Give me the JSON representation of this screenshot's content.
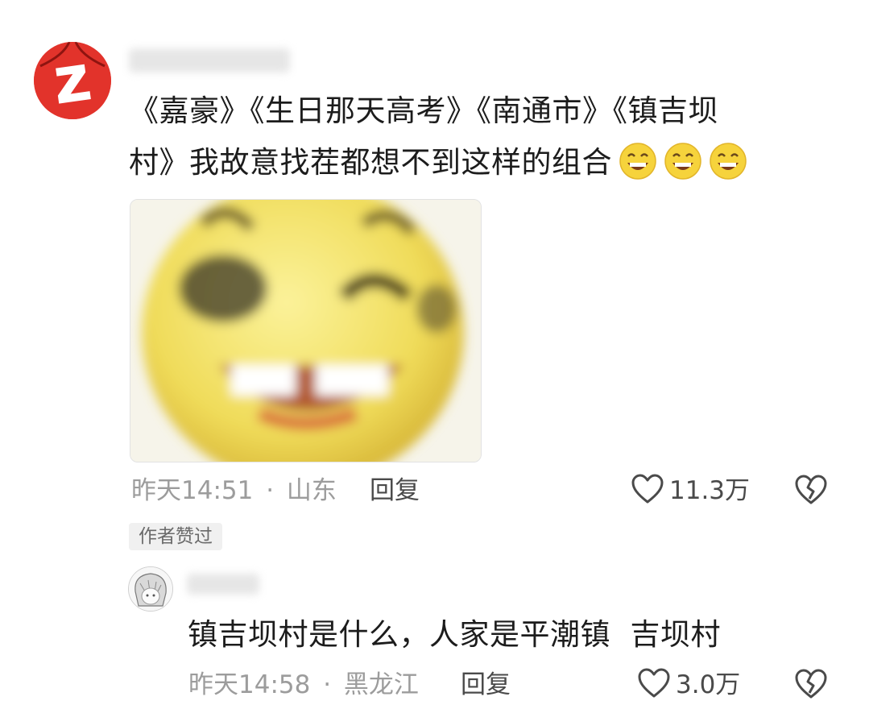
{
  "comment": {
    "username": "",
    "text_line1": "《嘉豪》《生日那天高考》《南通市》《镇吉坝",
    "text_line2": "村》我故意找茬都想不到这样的组合",
    "emojis": [
      "grinning-face",
      "grinning-face",
      "grinning-face"
    ],
    "time": "昨天14:51",
    "dot": "·",
    "location": "山东",
    "reply_label": "回复",
    "like_count": "11.3万",
    "author_badge": "作者赞过"
  },
  "reply": {
    "username": "",
    "text": "镇吉坝村是什么，人家是平潮镇  吉坝村",
    "time": "昨天14:58",
    "dot": "·",
    "location": "黑龙江",
    "reply_label": "回复",
    "like_count": "3.0万"
  },
  "colors": {
    "avatar_red": "#e2332b",
    "meta_gray": "#9c9c9c",
    "emoji_yellow": "#f6d33c"
  }
}
